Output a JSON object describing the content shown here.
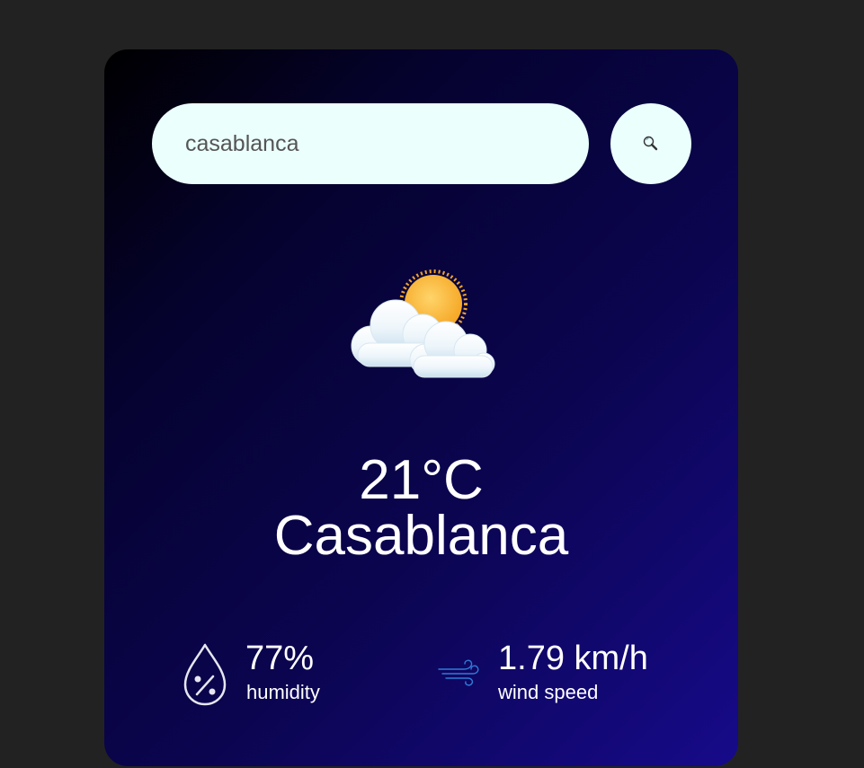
{
  "search": {
    "value": "casablanca",
    "button_icon": "search-icon"
  },
  "weather": {
    "icon": "partly-cloudy-icon",
    "temperature": "21°C",
    "city": "Casablanca"
  },
  "details": {
    "humidity": {
      "icon": "humidity-icon",
      "value": "77%",
      "label": "humidity"
    },
    "wind": {
      "icon": "wind-icon",
      "value": "1.79 km/h",
      "label": "wind speed"
    }
  },
  "colors": {
    "page_background": "#222222",
    "card_gradient_start": "#000000",
    "card_gradient_end": "#170a8a",
    "input_background": "#ebfffc",
    "text": "#ffffff"
  }
}
